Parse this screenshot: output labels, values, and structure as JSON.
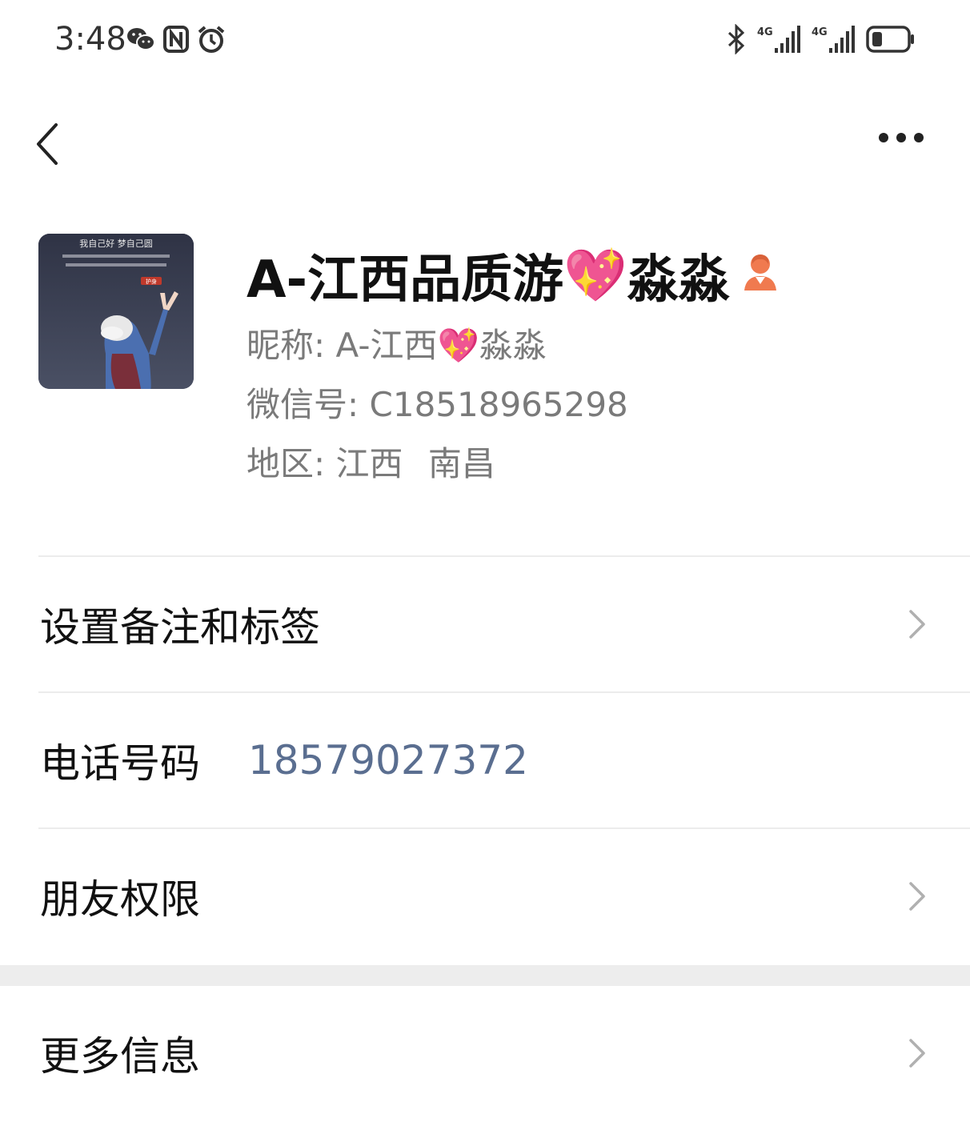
{
  "status_bar": {
    "time": "3:48",
    "left_icons": [
      "wechat-icon",
      "nfc-icon",
      "alarm-icon"
    ],
    "right_icons": [
      "bluetooth-icon",
      "signal-4g-1-icon",
      "signal-4g-2-icon",
      "battery-icon"
    ],
    "network_label_1": "4G",
    "network_label_2": "4G"
  },
  "nav": {
    "back_icon": "chevron-left-icon",
    "more_icon": "more-horizontal-icon"
  },
  "profile": {
    "display_name_prefix": "A-江西品质游",
    "display_name_suffix": "淼淼",
    "name_emoji": "💖",
    "badge_icon": "female-user-icon",
    "nickname_label": "昵称:",
    "nickname_prefix": "A-江西",
    "nickname_emoji": "💖",
    "nickname_suffix": "淼淼",
    "wechat_id_label": "微信号:",
    "wechat_id": "C18518965298",
    "region_label": "地区:",
    "region_province": "江西",
    "region_city": "南昌",
    "avatar_text_line1": "我自己好  梦自己圆",
    "avatar_text_tag": "护身"
  },
  "rows": {
    "remarks_label": "设置备注和标签",
    "phone_label": "电话号码",
    "phone_value": "18579027372",
    "permissions_label": "朋友权限",
    "more_info_label": "更多信息"
  },
  "colors": {
    "link_blue": "#5a6e90",
    "secondary_text": "#7a7a7a",
    "badge_orange": "#f07a4f",
    "divider": "#ececec"
  }
}
